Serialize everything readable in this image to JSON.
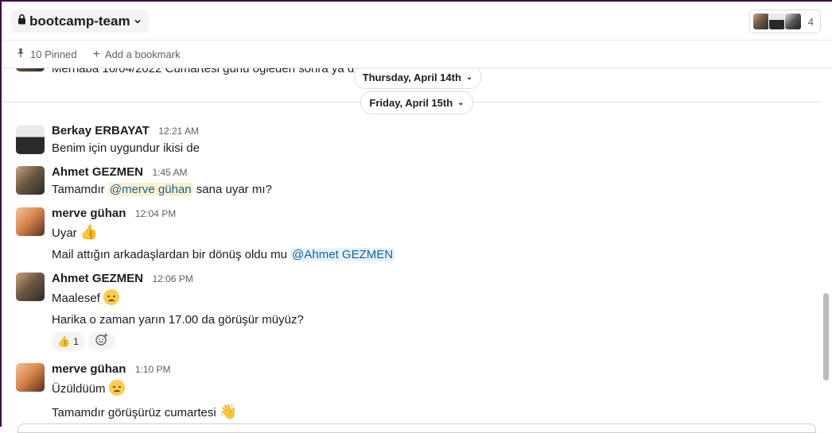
{
  "header": {
    "channel_name": "bootcamp-team",
    "member_count": "4"
  },
  "bookmarks": {
    "pinned_label": "10 Pinned",
    "add_label": "Add a bookmark"
  },
  "previous_message_text": "Merhaba 16/04/2022 Cumartesi günü öğleden sonra ya d",
  "day_dividers": [
    "Thursday, April 14th",
    "Friday, April 15th"
  ],
  "messages": [
    {
      "author": "Berkay ERBAYAT",
      "time": "12:21 AM",
      "lines": [
        "Benim için uygundur ikisi de"
      ]
    },
    {
      "author": "Ahmet GEZMEN",
      "time": "1:45 AM",
      "pre": "Tamamdır ",
      "mention": "@merve gühan",
      "post": " sana uyar mı?"
    },
    {
      "author": "merve gühan",
      "time": "12:04 PM",
      "line1": "Uyar",
      "line1_emoji": "👍",
      "line2_pre": "Mail attığın arkadaşlardan bir dönüş oldu mu ",
      "line2_mention": "@Ahmet GEZMEN"
    },
    {
      "author": "Ahmet GEZMEN",
      "time": "12:06 PM",
      "line1": "Maalesef",
      "line2": "Harika o zaman yarın 17.00 da görüşür müyüz?",
      "reaction_emoji": "👍",
      "reaction_count": "1"
    },
    {
      "author": "merve gühan",
      "time": "1:10 PM",
      "line1": "Üzüldüüm",
      "line2": "Tamamdır görüşürüz cumartesi",
      "line2_emoji": "👋"
    }
  ],
  "icons": {
    "lock": "lock-icon",
    "chevron": "chevron-down-icon",
    "pin": "pin-icon",
    "plus": "plus-icon",
    "add_reaction": "add-reaction-icon"
  }
}
